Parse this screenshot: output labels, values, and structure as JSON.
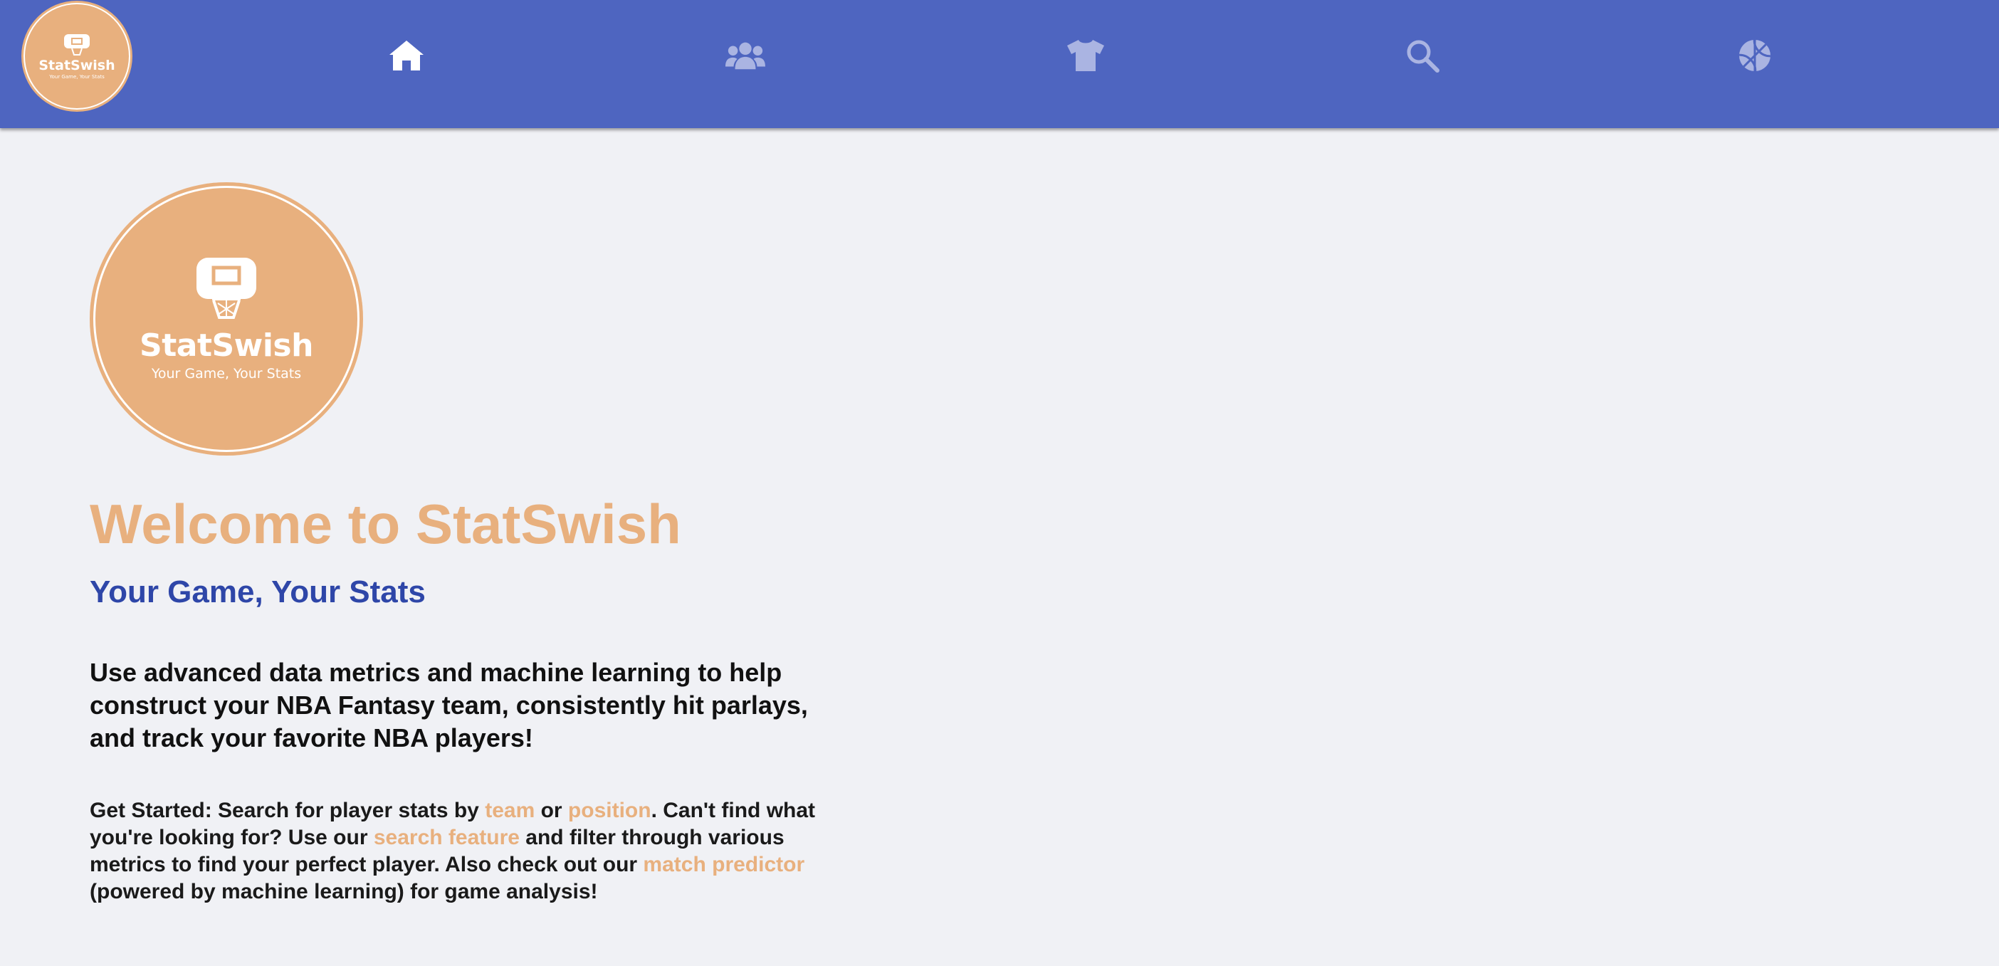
{
  "colors": {
    "navbar": "#4e65c0",
    "brand_orange": "#e8b07e",
    "subtitle_blue": "#2e46a8",
    "background": "#f0f1f5",
    "active_icon": "#ffffff",
    "inactive_icon": "#aab4e2"
  },
  "navbar": {
    "logo": {
      "name": "StatSwish",
      "tagline": "Your Game, Your Stats"
    },
    "items": [
      {
        "icon": "home-icon",
        "active": true
      },
      {
        "icon": "users-icon",
        "active": false
      },
      {
        "icon": "jersey-icon",
        "active": false
      },
      {
        "icon": "search-icon",
        "active": false
      },
      {
        "icon": "basketball-icon",
        "active": false
      }
    ]
  },
  "hero": {
    "logo": {
      "name": "StatSwish",
      "tagline": "Your Game, Your Stats"
    },
    "title": "Welcome to StatSwish",
    "subtitle": "Your Game, Your Stats",
    "intro": "Use advanced data metrics and machine learning to help construct your NBA Fantasy team, consistently hit parlays, and track your favorite NBA players!",
    "get_started": {
      "part1": "Get Started: Search for player stats by ",
      "team_link": "team",
      "part2": " or ",
      "position_link": "position",
      "part3": ". Can't find what you're looking for? Use our ",
      "search_link": "search feature",
      "part4": " and filter through various metrics to find your perfect player. Also check out our ",
      "match_link": "match predictor",
      "part5": " (powered by machine learning) for game analysis!"
    }
  }
}
